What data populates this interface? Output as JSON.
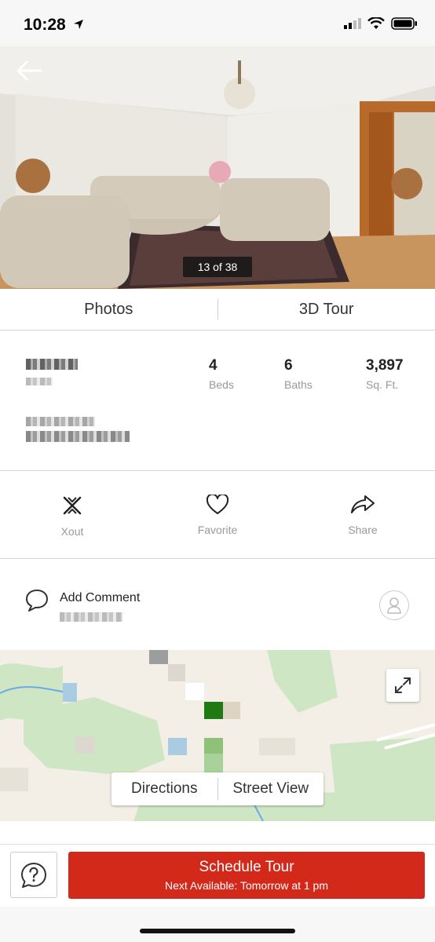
{
  "status_bar": {
    "time": "10:28"
  },
  "hero": {
    "photo_counter": "13 of 38"
  },
  "media_tabs": {
    "photos": "Photos",
    "tour": "3D Tour"
  },
  "summary": {
    "beds": {
      "value": "4",
      "label": "Beds"
    },
    "baths": {
      "value": "6",
      "label": "Baths"
    },
    "sqft": {
      "value": "3,897",
      "label": "Sq. Ft."
    }
  },
  "actions": {
    "xout": "Xout",
    "favorite": "Favorite",
    "share": "Share"
  },
  "comment": {
    "label": "Add Comment"
  },
  "map": {
    "directions": "Directions",
    "street_view": "Street View"
  },
  "cta": {
    "title": "Schedule Tour",
    "subtitle": "Next Available: Tomorrow at 1 pm"
  },
  "colors": {
    "accent": "#d3291b",
    "map_highlight": "#1f7a12"
  }
}
